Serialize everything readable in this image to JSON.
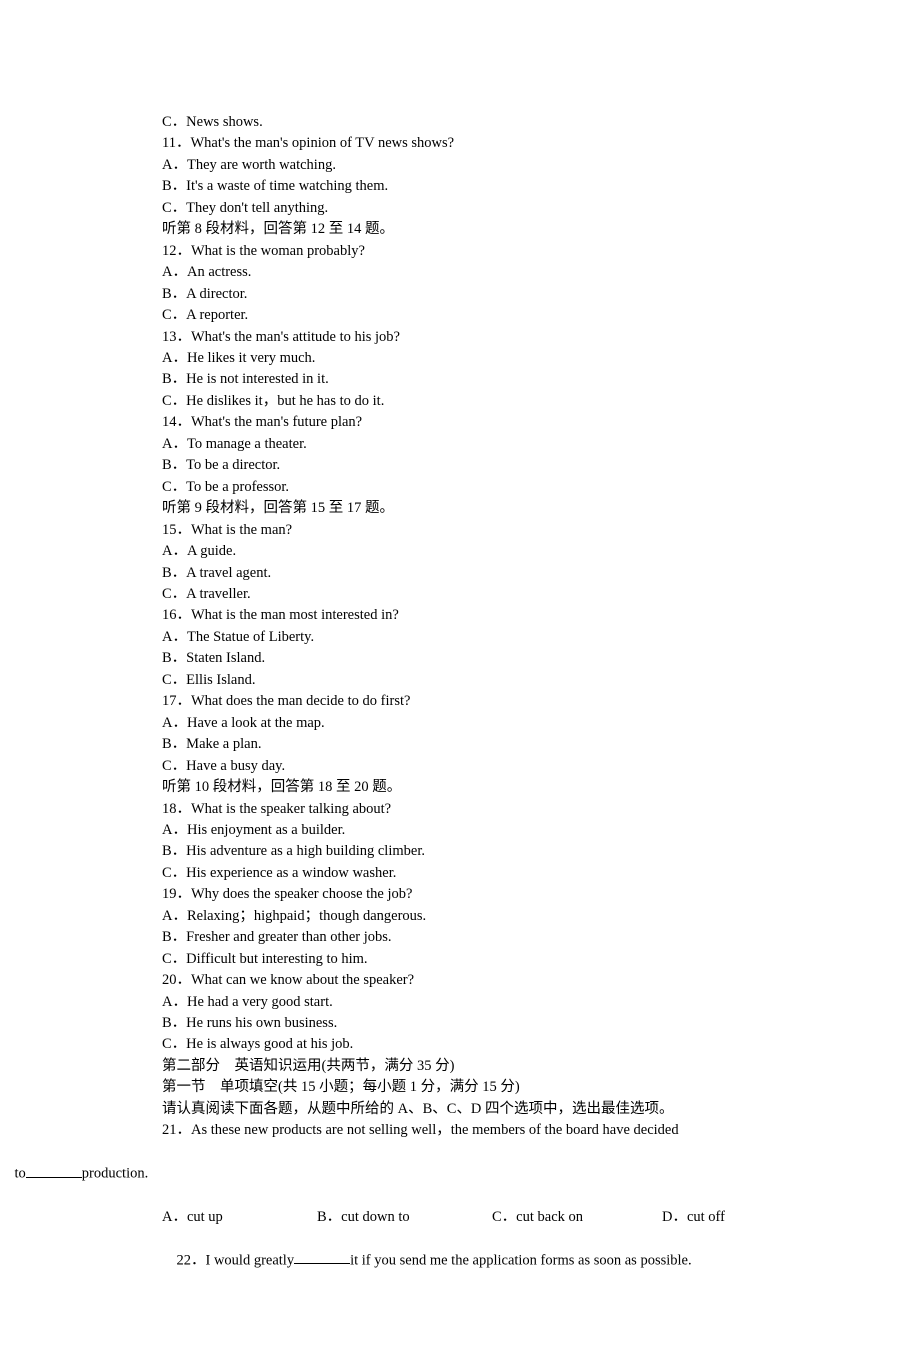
{
  "lines": {
    "l0": "C．News shows.",
    "l1": "11．What's the man's opinion of TV news shows?",
    "l2": "A．They are worth watching.",
    "l3": "B．It's a waste of time watching them.",
    "l4": "C．They don't tell anything.",
    "l5": "听第 8 段材料，回答第 12 至 14 题。",
    "l6": "12．What is the woman probably?",
    "l7": "A．An actress.",
    "l8": "B．A director.",
    "l9": "C．A reporter.",
    "l10": "13．What's the man's attitude to his job?",
    "l11": "A．He likes it very much.",
    "l12": "B．He is not interested in it.",
    "l13": "C．He dislikes it，but he has to do it.",
    "l14": "14．What's the man's future plan?",
    "l15": "A．To manage a theater.",
    "l16": "B．To be a director.",
    "l17": "C．To be a professor.",
    "l18": "听第 9 段材料，回答第 15 至 17 题。",
    "l19": "15．What is the man?",
    "l20": "A．A guide.",
    "l21": "B．A travel agent.",
    "l22": "C．A traveller.",
    "l23": "16．What is the man most interested in?",
    "l24": "A．The Statue of Liberty.",
    "l25": "B．Staten Island.",
    "l26": "C．Ellis Island.",
    "l27": "17．What does the man decide to do first?",
    "l28": "A．Have a look at the map.",
    "l29": "B．Make a plan.",
    "l30": "C．Have a busy day.",
    "l31": "听第 10 段材料，回答第 18 至 20 题。",
    "l32": "18．What is the speaker talking about?",
    "l33": "A．His enjoyment as a builder.",
    "l34": "B．His adventure as a high building climber.",
    "l35": "C．His experience as a window washer.",
    "l36": "19．Why does the speaker choose the job?",
    "l37": "A．Relaxing；high­paid；though dangerous.",
    "l38": "B．Fresher and greater than other jobs.",
    "l39": "C．Difficult but interesting to him.",
    "l40": "20．What can we know about the speaker?",
    "l41": "A．He had a very good start.",
    "l42": "B．He runs his own business.",
    "l43": "C．He is always good at his job.",
    "l44": "第二部分　英语知识运用(共两节，满分 35 分)",
    "l45": "第一节　单项填空(共 15 小题；每小题 1 分，满分 15 分)",
    "l46": "请认真阅读下面各题，从题中所给的 A、B、C、D 四个选项中，选出最佳选项。",
    "l47a": "21．As these new products are not selling well，the members of the board have decided ",
    "l47b_pre": "to",
    "l47b_post": "production.",
    "q21": {
      "a": "A．cut up",
      "b": "B．cut down to",
      "c": "C．cut back on",
      "d": "D．cut off"
    },
    "l48_pre": "22．I would greatly",
    "l48_post": "it if you send me the application forms as soon as possible."
  }
}
